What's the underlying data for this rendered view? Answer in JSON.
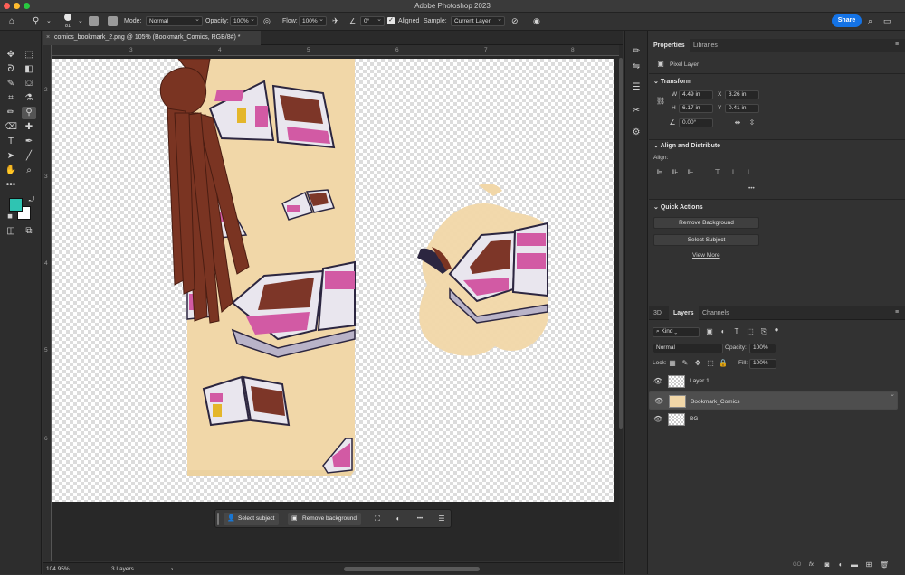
{
  "window": {
    "title": "Adobe Photoshop 2023"
  },
  "options_bar": {
    "brush_size": "81",
    "mode_label": "Mode:",
    "mode_value": "Normal",
    "opacity_label": "Opacity:",
    "opacity_value": "100%",
    "flow_label": "Flow:",
    "flow_value": "100%",
    "angle_value": "0°",
    "aligned_label": "Aligned",
    "sample_label": "Sample:",
    "sample_value": "Current Layer",
    "share_label": "Share"
  },
  "document": {
    "tab_title": "comics_bookmark_2.png @ 105% (Bookmark_Comics, RGB/8#) *",
    "close_glyph": "×"
  },
  "ruler": {
    "top_numbers": [
      "3",
      "4",
      "5",
      "6",
      "7",
      "8"
    ],
    "left_numbers": [
      "2",
      "3",
      "4",
      "5",
      "6"
    ]
  },
  "context_bar": {
    "select_subject": "Select subject",
    "remove_background": "Remove background",
    "more": "•••"
  },
  "status_bar": {
    "zoom": "104.95%",
    "layers_count": "3 Layers",
    "arrow": "›"
  },
  "properties_panel": {
    "tabs": [
      "Properties",
      "Libraries"
    ],
    "layer_type": "Pixel Layer",
    "transform": {
      "title": "Transform",
      "w_label": "W",
      "w_value": "4.49 in",
      "x_label": "X",
      "x_value": "3.26 in",
      "h_label": "H",
      "h_value": "6.17 in",
      "y_label": "Y",
      "y_value": "0.41 in",
      "angle_value": "0.00°"
    },
    "align": {
      "title": "Align and Distribute",
      "align_label": "Align:",
      "more": "•••"
    },
    "quick_actions": {
      "title": "Quick Actions",
      "remove_background": "Remove Background",
      "select_subject": "Select Subject",
      "view_more": "View More"
    }
  },
  "layers_panel": {
    "tabs": [
      "3D",
      "Layers",
      "Channels"
    ],
    "kind_value": "Kind",
    "blend_mode": "Normal",
    "opacity_label": "Opacity:",
    "opacity_value": "100%",
    "lock_label": "Lock:",
    "fill_label": "Fill:",
    "fill_value": "100%",
    "layers": [
      {
        "name": "Layer 1",
        "selected": false
      },
      {
        "name": "Bookmark_Comics",
        "selected": true
      },
      {
        "name": "BG",
        "selected": false
      }
    ],
    "footer_link": "GO",
    "footer_fx": "fx"
  },
  "colors": {
    "foreground": "#2fc4b2",
    "background": "#ffffff",
    "accent": "#1473e6",
    "bookmark_paper": "#f1d7a8",
    "tassel": "#7a3422",
    "comic_pink": "#d25aa4",
    "comic_brown": "#7d3628"
  }
}
